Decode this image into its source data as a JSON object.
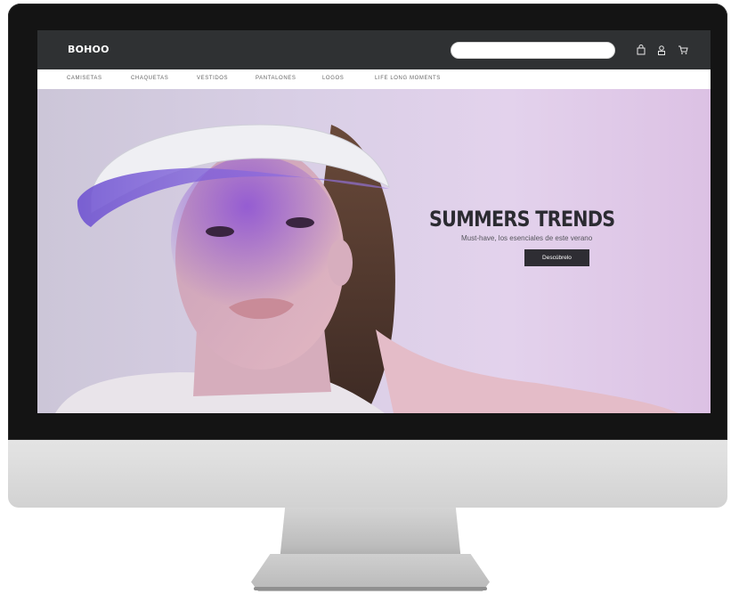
{
  "header": {
    "logo": "BOHOO",
    "search": {
      "value": "",
      "placeholder": ""
    },
    "icons": [
      "bag-icon",
      "user-icon",
      "cart-icon"
    ]
  },
  "nav": {
    "items": [
      {
        "label": "CAMISETAS"
      },
      {
        "label": "CHAQUETAS"
      },
      {
        "label": "VESTIDOS"
      },
      {
        "label": "PANTALONES"
      },
      {
        "label": "LOGOS"
      },
      {
        "label": "LIFE LONG MOMENTS"
      }
    ]
  },
  "hero": {
    "title": "SUMMERS TRENDS",
    "subtitle": "Must-have, los esenciales de este verano",
    "button_label": "Descúbrelo"
  },
  "colors": {
    "header_bg": "#2f3133",
    "button_bg": "#2e2d33",
    "hero_accent": "#8a4fd6"
  }
}
